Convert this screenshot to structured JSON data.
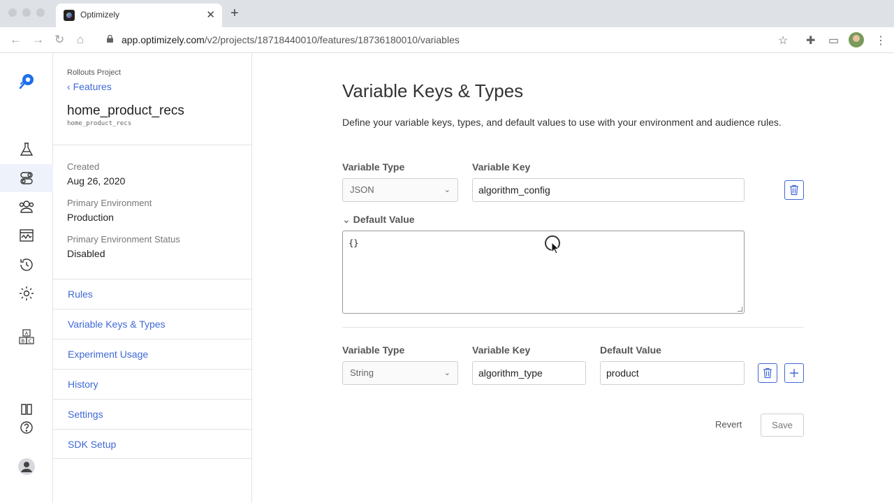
{
  "browser": {
    "tab_title": "Optimizely",
    "url_host": "app.optimizely.com",
    "url_path": "/v2/projects/18718440010/features/18736180010/variables"
  },
  "rail": {
    "icons": [
      "logo-icon",
      "flask-icon",
      "toggle-icon",
      "audiences-icon",
      "reports-icon",
      "history-icon",
      "settings-icon",
      "abc-icon",
      "book-icon",
      "help-icon",
      "user-icon"
    ]
  },
  "panel": {
    "project": "Rollouts Project",
    "back_label": "Features",
    "feature_name": "home_product_recs",
    "feature_key": "home_product_recs",
    "created_label": "Created",
    "created_value": "Aug 26, 2020",
    "env_label": "Primary Environment",
    "env_value": "Production",
    "status_label": "Primary Environment Status",
    "status_value": "Disabled",
    "nav": [
      "Rules",
      "Variable Keys & Types",
      "Experiment Usage",
      "History",
      "Settings",
      "SDK Setup"
    ]
  },
  "main": {
    "title": "Variable Keys & Types",
    "description": "Define your variable keys, types, and default values to use with your environment and audience rules.",
    "var1": {
      "type_label": "Variable Type",
      "type_value": "JSON",
      "key_label": "Variable Key",
      "key_value": "algorithm_config",
      "default_label": "Default Value",
      "default_value": "{}"
    },
    "var2": {
      "type_label": "Variable Type",
      "type_value": "String",
      "key_label": "Variable Key",
      "key_value": "algorithm_type",
      "default_label": "Default Value",
      "default_value": "product"
    },
    "revert_label": "Revert",
    "save_label": "Save"
  },
  "colors": {
    "accent": "#3e68d6",
    "brand": "#0037ff"
  }
}
